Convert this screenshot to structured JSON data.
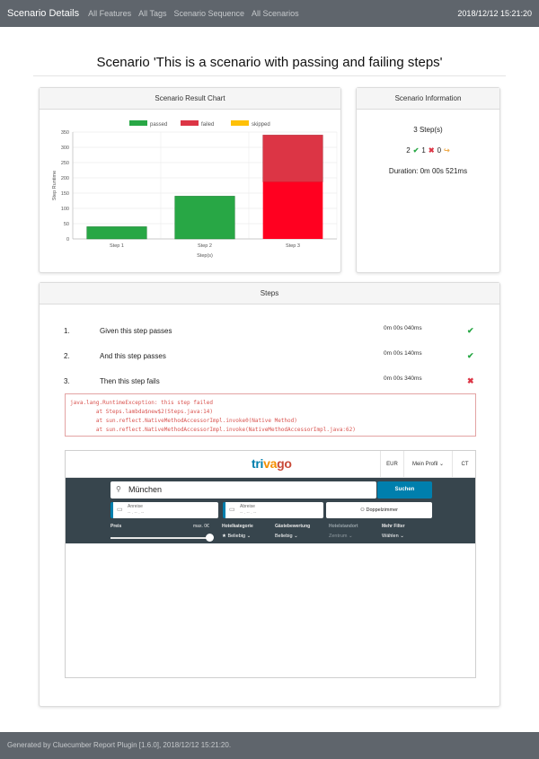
{
  "nav": {
    "brand": "Scenario Details",
    "links": [
      "All Features",
      "All Tags",
      "Scenario Sequence",
      "All Scenarios"
    ],
    "datetime": "2018/12/12 15:21:20"
  },
  "page": {
    "title": "Scenario 'This is a scenario with passing and failing steps'"
  },
  "chart_card": {
    "header": "Scenario Result Chart",
    "legend": [
      "passed",
      "failed",
      "skipped"
    ]
  },
  "colors": {
    "passed": "#28a745",
    "failed": "#dc3545",
    "skipped": "#ffc107",
    "failed_fill": "#ff0020"
  },
  "chart_data": {
    "type": "bar",
    "stacked": true,
    "categories": [
      "Step 1",
      "Step 2",
      "Step 3"
    ],
    "series": [
      {
        "name": "passed",
        "values": [
          40,
          140,
          0
        ]
      },
      {
        "name": "failed",
        "values": [
          0,
          0,
          340
        ]
      },
      {
        "name": "skipped",
        "values": [
          0,
          0,
          0
        ]
      }
    ],
    "xlabel": "Step(s)",
    "ylabel": "Step Runtime",
    "ylim": [
      0,
      350
    ],
    "yticks": [
      0,
      25,
      50,
      75,
      100,
      125,
      150,
      175,
      200,
      225,
      250,
      275,
      300,
      325,
      350
    ],
    "grid": true,
    "legend_position": "top"
  },
  "info_card": {
    "header": "Scenario Information",
    "steps": "3 Step(s)",
    "passed": "2",
    "failed": "1",
    "skipped": "0",
    "duration": "Duration: 0m 00s 521ms"
  },
  "steps_card": {
    "header": "Steps",
    "steps": [
      {
        "num": "1.",
        "text": "Given this step passes",
        "time": "0m 00s 040ms",
        "status": "passed",
        "icon": "✔"
      },
      {
        "num": "2.",
        "text": "And this step passes",
        "time": "0m 00s 140ms",
        "status": "passed",
        "icon": "✔"
      },
      {
        "num": "3.",
        "text": "Then this step fails",
        "time": "0m 00s 340ms",
        "status": "failed",
        "icon": "✖"
      }
    ],
    "error_lines": [
      "java.lang.RuntimeException: this step failed",
      "        at Steps.lambda$new$2(Steps.java:14)",
      "        at sun.reflect.NativeMethodAccessorImpl.invoke0(Native Method)",
      "        at sun.reflect.NativeMethodAccessorImpl.invoke(NativeMethodAccessorImpl.java:62)"
    ]
  },
  "screenshot": {
    "logo": {
      "a": "tri",
      "b": "va",
      "c": "go"
    },
    "nav": [
      "EUR",
      "Mein Profil",
      "CT"
    ],
    "search_value": "München",
    "search_button": "Suchen",
    "arrival_label": "Anreise",
    "departure_label": "Abreise",
    "date_placeholder": "-- . -- . --",
    "room": "Doppelzimmer",
    "price_label": "Preis",
    "price_max": "max. 0€",
    "filters": [
      {
        "label": "Hotelkategorie",
        "value": "★ Beliebig"
      },
      {
        "label": "Gästebewertung",
        "value": "Beliebig"
      },
      {
        "label": "Hotelstandort",
        "value": "Zentrum"
      },
      {
        "label": "Mehr Filter",
        "value": "Wählen"
      }
    ]
  },
  "footer": {
    "text": "Generated by Cluecumber Report Plugin [1.6.0], 2018/12/12 15:21:20."
  }
}
